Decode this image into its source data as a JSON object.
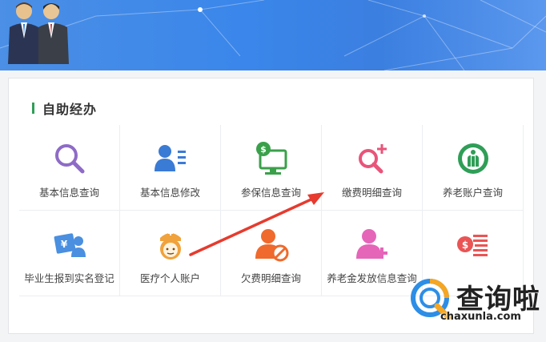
{
  "section": {
    "title": "自助经办"
  },
  "services": [
    {
      "label": "基本信息查询",
      "icon": "search-icon",
      "color": "#8e6bc7"
    },
    {
      "label": "基本信息修改",
      "icon": "user-list-icon",
      "color": "#3a7bd5"
    },
    {
      "label": "参保信息查询",
      "icon": "monitor-dollar-icon",
      "color": "#3aa14a"
    },
    {
      "label": "缴费明细查询",
      "icon": "search-plus-icon",
      "color": "#e9547a"
    },
    {
      "label": "养老账户查询",
      "icon": "pension-logo-icon",
      "color": "#2f9e57"
    },
    {
      "label": "毕业生报到实名登记",
      "icon": "graduate-card-icon",
      "color": "#4a8fe0"
    },
    {
      "label": "医疗个人账户",
      "icon": "nurse-icon",
      "color": "#f0a23c"
    },
    {
      "label": "欠费明细查询",
      "icon": "user-block-icon",
      "color": "#ef6a2c"
    },
    {
      "label": "养老金发放信息查询",
      "icon": "user-plus-icon",
      "color": "#e565b9"
    },
    {
      "label": "",
      "icon": "money-list-icon",
      "color": "#ea5454"
    }
  ],
  "watermark": {
    "name": "查询啦",
    "url": "chaxunla.com",
    "icon": "search-q-logo-icon"
  }
}
